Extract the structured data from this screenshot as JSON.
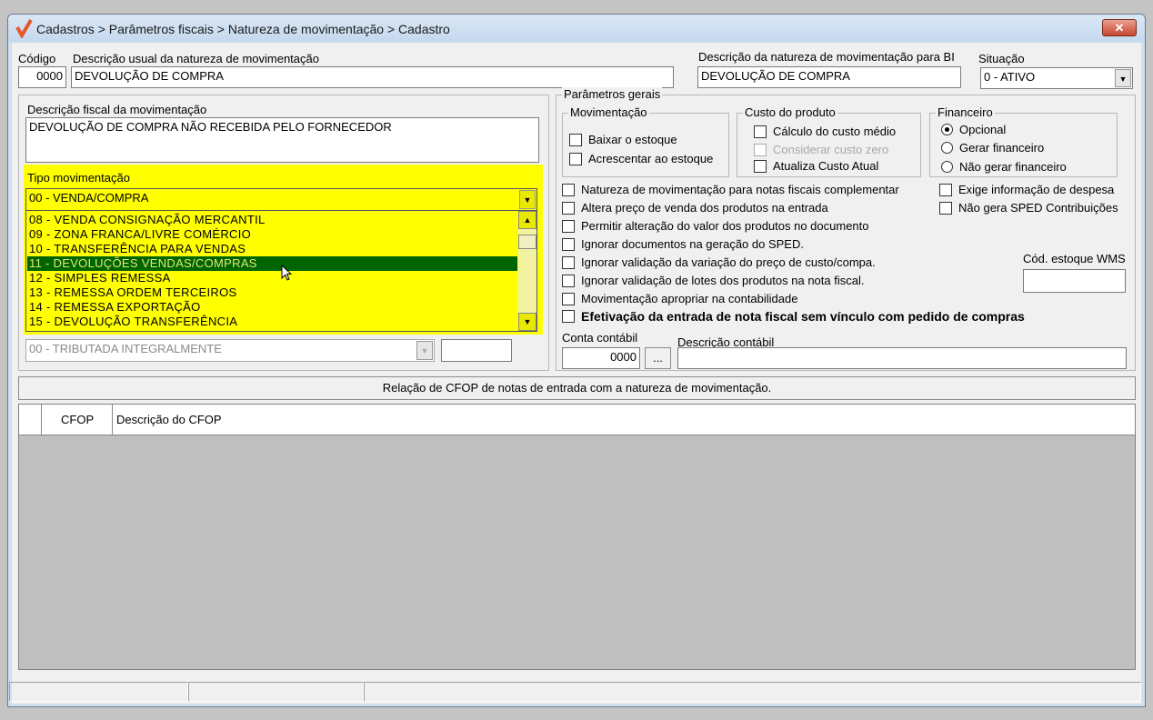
{
  "window": {
    "title": "Cadastros > Parâmetros fiscais > Natureza de movimentação > Cadastro",
    "close_label": "✕"
  },
  "header": {
    "codigo_label": "Código",
    "codigo_value": "0000",
    "descricao_usual_label": "Descrição usual da natureza de movimentação",
    "descricao_usual_value": "DEVOLUÇÃO DE COMPRA",
    "descricao_bi_label": "Descrição da natureza de movimentação para BI",
    "descricao_bi_value": "DEVOLUÇÃO DE COMPRA",
    "situacao_label": "Situação",
    "situacao_value": "0 - ATIVO"
  },
  "left": {
    "descricao_fiscal_label": "Descrição fiscal da movimentação",
    "descricao_fiscal_value": "DEVOLUÇÃO DE COMPRA NÃO RECEBIDA PELO FORNECEDOR",
    "tipo_label": "Tipo movimentação",
    "tipo_value": "00 - VENDA/COMPRA",
    "tipo_options": [
      "08 - VENDA CONSIGNAÇÃO MERCANTIL",
      "09 - ZONA FRANCA/LIVRE COMÉRCIO",
      "10 - TRANSFERÊNCIA PARA VENDAS",
      "11 - DEVOLUÇÕES VENDAS/COMPRAS",
      "12 - SIMPLES REMESSA",
      "13 - REMESSA ORDEM TERCEIROS",
      "14 - REMESSA EXPORTAÇÃO",
      "15 - DEVOLUÇÃO TRANSFERÊNCIA"
    ],
    "tipo_hovered": "11 - DEVOLUÇÕES VENDAS/COMPRAS",
    "tributacao_value": "00 - TRIBUTADA INTEGRALMENTE"
  },
  "params": {
    "title": "Parâmetros gerais",
    "movimentacao": {
      "title": "Movimentação",
      "items": [
        "Baixar o estoque",
        "Acrescentar ao estoque"
      ]
    },
    "custo": {
      "title": "Custo do produto",
      "items": [
        "Cálculo do custo médio",
        "Considerar custo zero",
        "Atualiza Custo Atual"
      ]
    },
    "financeiro": {
      "title": "Financeiro",
      "options": [
        "Opcional",
        "Gerar financeiro",
        "Não gerar financeiro"
      ],
      "selected": "Opcional"
    },
    "checks": [
      "Natureza de movimentação para notas fiscais complementar",
      "Altera preço de venda dos produtos na entrada",
      "Permitir alteração do valor dos produtos no documento",
      "Ignorar documentos na geração do SPED.",
      "Ignorar validação da variação do preço de custo/compa.",
      "Ignorar validação de lotes dos produtos na nota fiscal.",
      "Movimentação apropriar na contabilidade",
      "Efetivação da entrada de nota fiscal sem vínculo com pedido de compras"
    ],
    "checks_right": [
      "Exige informação de despesa",
      "Não gera SPED Contribuições"
    ],
    "wms_label": "Cód. estoque WMS",
    "wms_value": "",
    "conta_label": "Conta contábil",
    "conta_value": "0000",
    "conta_button": "...",
    "desc_contabil_label": "Descrição contábil",
    "desc_contabil_value": ""
  },
  "cfop": {
    "bar_label": "Relação de CFOP de notas de entrada com a natureza de movimentação.",
    "columns": [
      "CFOP",
      "Descrição do CFOP"
    ],
    "rows": []
  },
  "colors": {
    "highlight": "#ffff00",
    "selection": "#006400"
  }
}
